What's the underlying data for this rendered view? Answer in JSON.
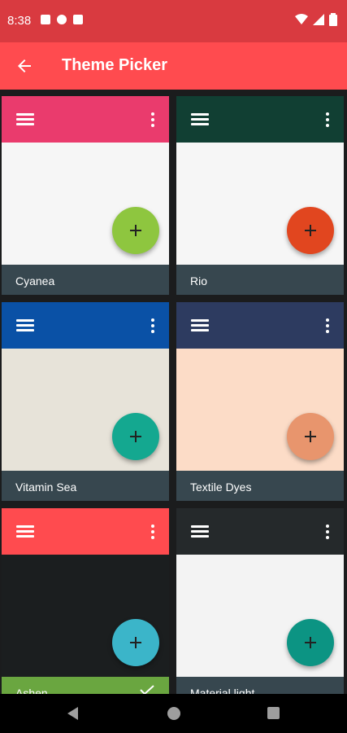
{
  "status": {
    "time": "8:38"
  },
  "appbar": {
    "title": "Theme Picker"
  },
  "themes": [
    {
      "name": "Cyanea",
      "primary": "#ea3b6d",
      "background": "#f6f6f6",
      "accent": "#8ec63f",
      "label_bg": "#37474f",
      "selected": false
    },
    {
      "name": "Rio",
      "primary": "#113f33",
      "background": "#f6f6f6",
      "accent": "#e1461f",
      "label_bg": "#37474f",
      "selected": false
    },
    {
      "name": "Vitamin Sea",
      "primary": "#0a51a6",
      "background": "#e7e3d9",
      "accent": "#14a890",
      "label_bg": "#37474f",
      "selected": false
    },
    {
      "name": "Textile Dyes",
      "primary": "#2d3b60",
      "background": "#fcdcc7",
      "accent": "#e8956d",
      "label_bg": "#37474f",
      "selected": false
    },
    {
      "name": "Ashen",
      "primary": "#ff4b4f",
      "background": "#1b1e1f",
      "accent": "#3bb5c9",
      "label_bg": "#6aa640",
      "selected": true
    },
    {
      "name": "Material light",
      "primary": "#25292b",
      "background": "#f3f3f3",
      "accent": "#0c9483",
      "label_bg": "#37474f",
      "selected": false
    }
  ]
}
